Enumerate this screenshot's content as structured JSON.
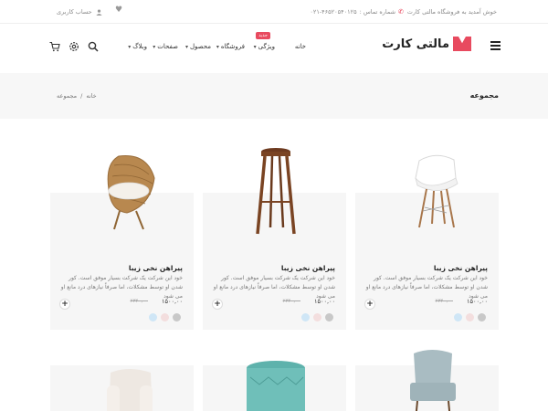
{
  "topbar": {
    "welcome": "خوش آمدید به فروشگاه مالتی کارت",
    "phone_label": "شماره تماس :",
    "phone_number": "۰۲۱-۴۶۵۲۰۵۴۰۱۲۵",
    "account_label": "حساب کاربری"
  },
  "header": {
    "logo_text": "مالتی کارت",
    "nav": {
      "home": "خانه",
      "features": "ویژگی",
      "shop": "فروشگاه",
      "product": "محصول",
      "pages": "صفحات",
      "blog": "وبلاگ"
    },
    "badge": "جدید"
  },
  "breadcrumb": {
    "title": "مجموعه",
    "home": "خانه",
    "separator": "/",
    "current": "مجموعه"
  },
  "products": [
    {
      "title": "پیراهن نخی زیبا",
      "desc": "خود این شرکت یک شرکت بسیار موفق است. کور شدن او توسط مشکلات، اما صرفاً نیازهای درد مانع او می شود",
      "price": "۱۵۰۰,۰۰",
      "old_price": "۲۳۴۰,۰۰",
      "add": "+",
      "swatches": [
        "#c8c8c8",
        "#f3dede",
        "#cfe6f6"
      ]
    },
    {
      "title": "پیراهن نخی زیبا",
      "desc": "خود این شرکت یک شرکت بسیار موفق است. کور شدن او توسط مشکلات، اما صرفاً نیازهای درد مانع او می شود",
      "price": "۱۵۰۰,۰۰",
      "old_price": "۲۳۴۰,۰۰",
      "add": "+",
      "swatches": [
        "#c8c8c8",
        "#f3dede",
        "#cfe6f6"
      ]
    },
    {
      "title": "پیراهن نخی زیبا",
      "desc": "خود این شرکت یک شرکت بسیار موفق است. کور شدن او توسط مشکلات، اما صرفاً نیازهای درد مانع او می شود",
      "price": "۱۵۰۰,۰۰",
      "old_price": "۲۳۴۰,۰۰",
      "add": "+",
      "swatches": [
        "#c8c8c8",
        "#f3dede",
        "#cfe6f6"
      ]
    }
  ],
  "colors": {
    "accent": "#e84a5f",
    "card_bg": "#f6f6f6",
    "band_bg": "#f7f7f7"
  },
  "icons": [
    "user-icon",
    "heart-icon",
    "phone-icon",
    "search-icon",
    "settings-icon",
    "cart-icon",
    "menu-icon"
  ]
}
